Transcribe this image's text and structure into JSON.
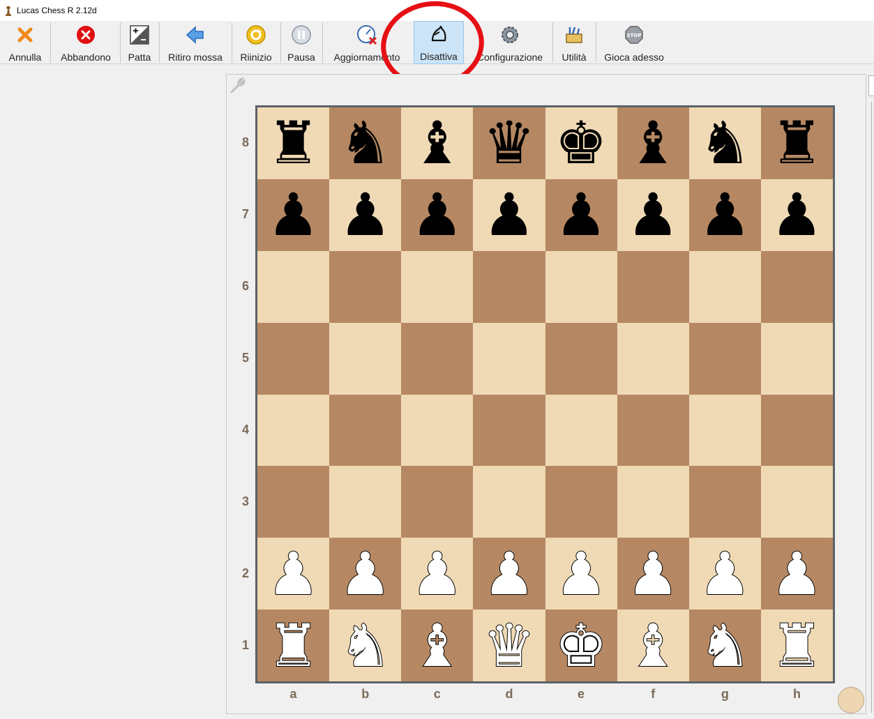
{
  "window": {
    "title": "Lucas Chess R 2.12d"
  },
  "toolbar": {
    "buttons": [
      {
        "label": "Annulla",
        "icon": "cross-icon"
      },
      {
        "label": "Abbandono",
        "icon": "red-x-circle-icon"
      },
      {
        "label": "Patta",
        "icon": "plus-minus-icon"
      },
      {
        "label": "Ritiro mossa",
        "icon": "blue-arrow-left-icon"
      },
      {
        "label": "Riinizio",
        "icon": "restart-icon"
      },
      {
        "label": "Pausa",
        "icon": "pause-icon"
      },
      {
        "label": "Aggiornamento",
        "icon": "gauge-cancel-icon"
      },
      {
        "label": "Disattiva",
        "icon": "knight-outline-icon",
        "active": true
      },
      {
        "label": "Configurazione",
        "icon": "gear-icon"
      },
      {
        "label": "Utilità",
        "icon": "toolbox-icon"
      },
      {
        "label": "Gioca adesso",
        "icon": "stop-sign-icon"
      }
    ]
  },
  "board": {
    "ranks": [
      "8",
      "7",
      "6",
      "5",
      "4",
      "3",
      "2",
      "1"
    ],
    "files": [
      "a",
      "b",
      "c",
      "d",
      "e",
      "f",
      "g",
      "h"
    ],
    "position": [
      [
        "r",
        "n",
        "b",
        "q",
        "k",
        "b",
        "n",
        "r"
      ],
      [
        "p",
        "p",
        "p",
        "p",
        "p",
        "p",
        "p",
        "p"
      ],
      [
        "",
        "",
        "",
        "",
        "",
        "",
        "",
        ""
      ],
      [
        "",
        "",
        "",
        "",
        "",
        "",
        "",
        ""
      ],
      [
        "",
        "",
        "",
        "",
        "",
        "",
        "",
        ""
      ],
      [
        "",
        "",
        "",
        "",
        "",
        "",
        "",
        ""
      ],
      [
        "P",
        "P",
        "P",
        "P",
        "P",
        "P",
        "P",
        "P"
      ],
      [
        "R",
        "N",
        "B",
        "Q",
        "K",
        "B",
        "N",
        "R"
      ]
    ],
    "light_color": "#f0d9b5",
    "dark_color": "#b58863"
  },
  "annotation": {
    "color": "#e60f14",
    "target": "Disattiva"
  }
}
